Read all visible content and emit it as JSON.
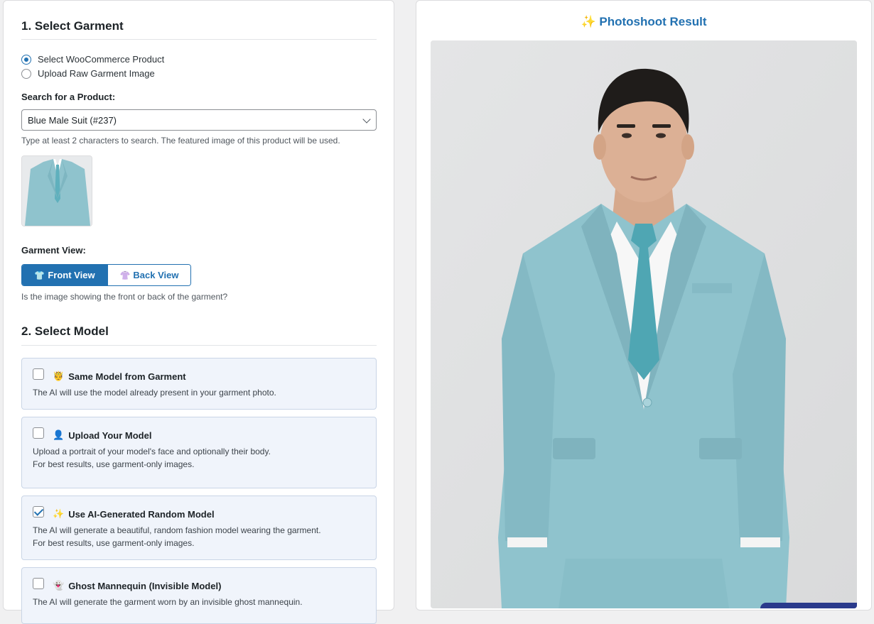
{
  "garment": {
    "heading": "1. Select Garment",
    "source_options": [
      {
        "label": "Select WooCommerce Product",
        "selected": true
      },
      {
        "label": "Upload Raw Garment Image",
        "selected": false
      }
    ],
    "search_label": "Search for a Product:",
    "selected_product": "Blue Male Suit (#237)",
    "search_hint": "Type at least 2 characters to search. The featured image of this product will be used.",
    "view_label": "Garment View:",
    "views": [
      {
        "icon": "👕",
        "label": "Front View",
        "active": true
      },
      {
        "icon": "👚",
        "label": "Back View",
        "active": false
      }
    ],
    "view_hint": "Is the image showing the front or back of the garment?"
  },
  "model": {
    "heading": "2. Select Model",
    "options": [
      {
        "icon": "🤴",
        "title": "Same Model from Garment",
        "lines": [
          "The AI will use the model already present in your garment photo."
        ],
        "checked": false
      },
      {
        "icon": "👤",
        "title": "Upload Your Model",
        "lines": [
          "Upload a portrait of your model's face and optionally their body.",
          "For best results, use garment-only images."
        ],
        "checked": false
      },
      {
        "icon": "✨",
        "title": "Use AI-Generated Random Model",
        "lines": [
          "The AI will generate a beautiful, random fashion model wearing the garment.",
          "For best results, use garment-only images."
        ],
        "checked": true
      },
      {
        "icon": "👻",
        "title": "Ghost Mannequin (Invisible Model)",
        "lines": [
          "The AI will generate the garment worn by an invisible ghost mannequin."
        ],
        "checked": false
      }
    ]
  },
  "result": {
    "title": "✨ Photoshoot Result"
  },
  "colors": {
    "accent": "#2271b1",
    "suit": "#8fc3cd",
    "card_bg": "#f0f4fb"
  }
}
